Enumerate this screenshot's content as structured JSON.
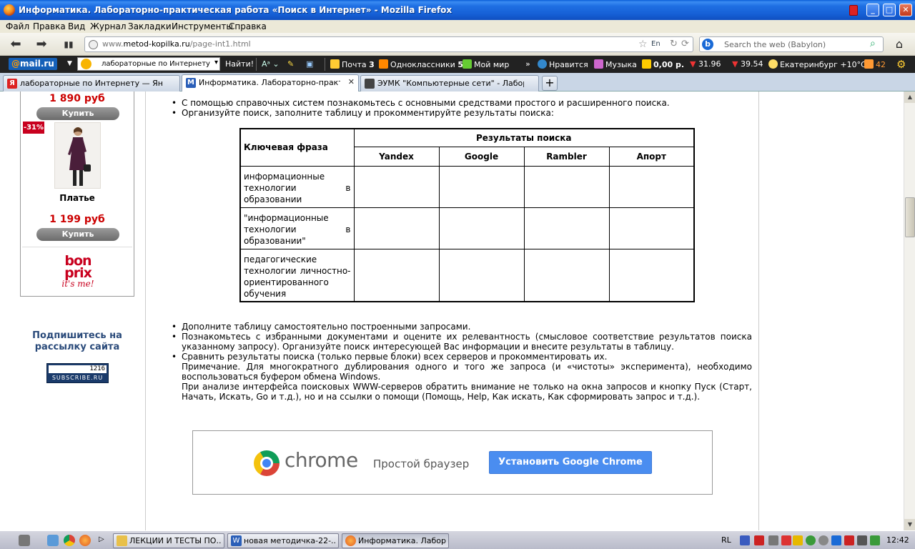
{
  "window": {
    "title": "Информатика. Лабораторно-практическая работа «Поиск в Интернет» - Mozilla Firefox",
    "min": "_",
    "max": "□",
    "close": "✕"
  },
  "menu": [
    "Файл",
    "Правка",
    "Вид",
    "Журнал",
    "Закладки",
    "Инструменты",
    "Справка"
  ],
  "nav": {
    "back": "⬅",
    "forward": "➡",
    "url_prefix": "www.",
    "url_domain": "metod-kopilka.ru",
    "url_path": "/page-int1.html",
    "star": "☆",
    "lang": "En",
    "reload": "↻",
    "stop": "⟳",
    "search_placeholder": "Search the web (Babylon)",
    "search_engine": "b"
  },
  "mailbar": {
    "logo_at": "@",
    "logo_text": "mail.ru",
    "query": "лабораторные по Интернету",
    "find": "Найти!",
    "mail": "Почта",
    "mail_count": "3",
    "ok": "Одноклассники",
    "ok_count": "5",
    "mymir": "Мой мир",
    "more": "»",
    "like": "Нравится",
    "music": "Музыка",
    "money": "0,00 р.",
    "usd": "31.96",
    "eur": "39.54",
    "weather": "Екатеринбург +10°C",
    "notif_count": "42"
  },
  "tabs": [
    {
      "label": "лабораторные по Интернету — Яндекс...",
      "fav": "Я",
      "color": "#d22"
    },
    {
      "label": "Информатика. Лабораторно-практиче...",
      "fav": "M",
      "color": "#2b5fb8",
      "active": true
    },
    {
      "label": "ЭУМК \"Компьютерные сети\" - Лаборат...",
      "fav": "",
      "color": "#444"
    }
  ],
  "sidebar": {
    "price1": "1 890 руб",
    "buy": "Купить",
    "badge": "-31%",
    "product": "Платье",
    "price2": "1 199 руб",
    "brand_l1": "bon",
    "brand_l2": "prix",
    "brand_l3": "it's me!",
    "subscribe_title": "Подпишитесь на рассылку сайта",
    "subscribe_count": "1216",
    "subscribe_label": "SUBSCRIBE.RU"
  },
  "content": {
    "bullet1": "С помощью справочных систем познакомьтесь с основными средствами простого и расширенного поиска.",
    "bullet2": "Организуйте поиск, заполните таблицу и прокомментируйте результаты поиска:",
    "table": {
      "phrase_header": "Ключевая фраза",
      "results_header": "Результаты поиска",
      "engines": [
        "Yandex",
        "Google",
        "Rambler",
        "Апорт"
      ],
      "rows": [
        "информационные технологии в образовании",
        "\"информационные технологии в образовании\"",
        "педагогические технологии личностно-ориентированного обучения"
      ]
    },
    "bullet3": "Дополните таблицу самостоятельно построенными запросами.",
    "bullet4": "Познакомьтесь с избранными документами и оцените их релевантность (смысловое соответствие результатов поиска указанному запросу). Организуйте поиск интересующей Вас информации и внесите результаты в таблицу.",
    "bullet5": "Сравнить результаты поиска (только первые блоки) всех серверов и прокомментировать их.",
    "note1": "Примечание. Для многократного дублирования одного и того же запроса (и «чистоты» эксперимента), необходимо воспользоваться буфером обмена Windows.",
    "note2": "При анализе интерфейса поисковых WWW-серверов обратить внимание не только на окна запросов и кнопку Пуск (Старт, Начать, Искать, Go и т.д.), но и на ссылки о помощи (Помощь, Help, Как искать, Как сформировать запрос и т.д.)."
  },
  "chrome_ad": {
    "word": "chrome",
    "tagline": "Простой браузер",
    "button": "Установить Google Chrome"
  },
  "taskbar": {
    "tasks": [
      {
        "label": "ЛЕКЦИИ И ТЕСТЫ ПО...",
        "color": "#e8c04a"
      },
      {
        "label": "новая методичка-22-...",
        "color": "#2b5fb8"
      },
      {
        "label": "Информатика. Лабор...",
        "color": "#e8742a",
        "active": true
      }
    ],
    "lang": "RL",
    "clock": "12:42"
  },
  "colors": {
    "accent_red": "#cc0000",
    "chrome_button": "#4a8df0",
    "titlebar": "#1f6fe3"
  }
}
